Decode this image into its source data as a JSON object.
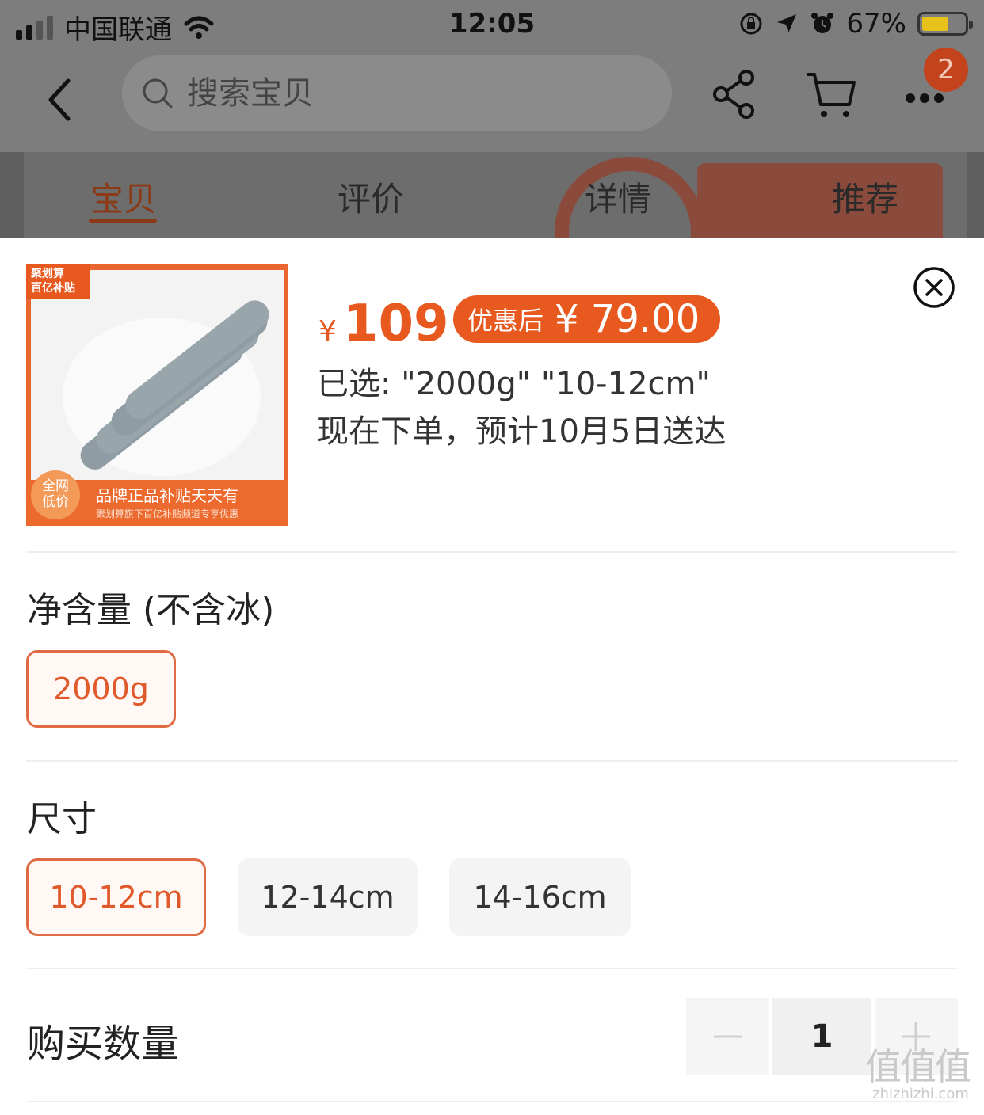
{
  "status_bar": {
    "carrier": "中国联通",
    "time": "12:05",
    "battery_percent": "67%",
    "battery_level": 0.67
  },
  "nav": {
    "search_placeholder": "搜索宝贝",
    "badge_count": "2"
  },
  "tabs": [
    {
      "label": "宝贝",
      "active": true
    },
    {
      "label": "评价",
      "active": false
    },
    {
      "label": "详情",
      "active": false
    },
    {
      "label": "推荐",
      "active": false
    }
  ],
  "thumb": {
    "tag_line1": "聚划算",
    "tag_line2": "百亿补贴",
    "circle_line1": "全网",
    "circle_line2": "低价",
    "banner": "品牌正品补贴天天有",
    "subbanner": "聚划算旗下百亿补贴频道专享优惠"
  },
  "product": {
    "currency": "¥",
    "price": "109",
    "coupon_label": "优惠后",
    "coupon_price": "¥ 79.00",
    "selected_text": "已选: \"2000g\" \"10-12cm\"",
    "delivery_text": "现在下单，预计10月5日送达"
  },
  "weight_section": {
    "title": "净含量 (不含冰)",
    "options": [
      {
        "label": "2000g",
        "selected": true
      }
    ]
  },
  "size_section": {
    "title": "尺寸",
    "options": [
      {
        "label": "10-12cm",
        "selected": true
      },
      {
        "label": "12-14cm",
        "selected": false
      },
      {
        "label": "14-16cm",
        "selected": false
      }
    ]
  },
  "quantity": {
    "label": "购买数量",
    "value": "1"
  },
  "watermark": {
    "main": "值值值",
    "url": "zhizhizhi.com"
  },
  "colors": {
    "accent": "#e8591f",
    "selected_border": "#e06a44",
    "overlay": "#7d7d7d"
  }
}
